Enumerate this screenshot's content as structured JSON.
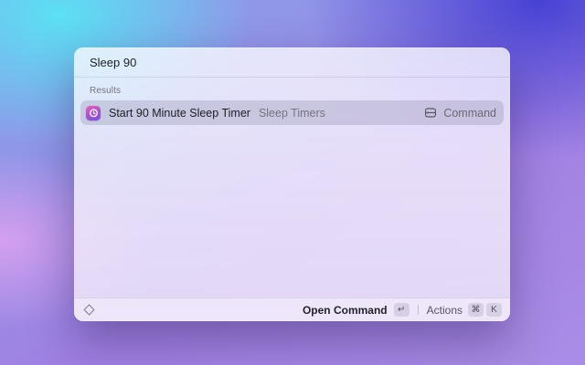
{
  "launcher": {
    "search": {
      "value": "Sleep 90"
    },
    "results": {
      "section_label": "Results",
      "items": [
        {
          "icon": "sleep-timers-app-icon",
          "title": "Start 90 Minute Sleep Timer",
          "subtitle": "Sleep Timers",
          "accessory": {
            "icon": "command-type-icon",
            "label": "Command"
          },
          "selected": true
        }
      ]
    },
    "footer": {
      "logo": "raycast-logo-icon",
      "primary": {
        "label": "Open Command",
        "key": "↵"
      },
      "secondary": {
        "label": "Actions",
        "keys": [
          "⌘",
          "K"
        ]
      }
    },
    "colors": {
      "background_top_left": "#5be0f3",
      "background_top_right": "#4741d4",
      "background_bottom": "#a98de5",
      "app_icon_gradient_top": "#ef5cb8",
      "app_icon_gradient_bottom": "#7a4fdc",
      "selection_background": "rgba(104,101,130,0.22)",
      "title_text": "#1d1d25",
      "muted_text": "#76737f"
    }
  }
}
